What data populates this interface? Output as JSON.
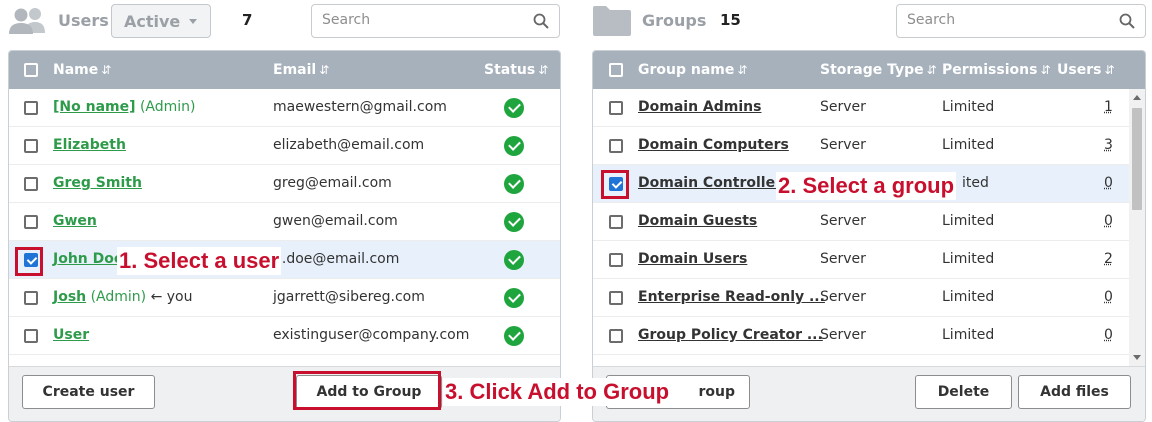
{
  "users_panel": {
    "title": "Users",
    "filter": "Active",
    "count": "7",
    "search_placeholder": "Search",
    "columns": {
      "name": "Name",
      "email": "Email",
      "status": "Status"
    },
    "sort_glyph": "⇵",
    "rows": [
      {
        "name": "[No name]",
        "suffix": "(Admin)",
        "extra": "",
        "email": "maewestern@gmail.com",
        "checked": false
      },
      {
        "name": "Elizabeth",
        "suffix": "",
        "extra": "",
        "email": "elizabeth@email.com",
        "checked": false
      },
      {
        "name": "Greg Smith",
        "suffix": "",
        "extra": "",
        "email": "greg@email.com",
        "checked": false
      },
      {
        "name": "Gwen",
        "suffix": "",
        "extra": "",
        "email": "gwen@email.com",
        "checked": false
      },
      {
        "name": "John Doe",
        "suffix": "",
        "extra": "",
        "email": "n.doe@email.com",
        "checked": true
      },
      {
        "name": "Josh",
        "suffix": "(Admin)",
        "extra": "← you",
        "email": "jgarrett@sibereg.com",
        "checked": false
      },
      {
        "name": "User",
        "suffix": "",
        "extra": "",
        "email": "existinguser@company.com",
        "checked": false
      }
    ],
    "buttons": {
      "create_user": "Create user",
      "add_to_group": "Add to Group"
    }
  },
  "groups_panel": {
    "title": "Groups",
    "count": "15",
    "search_placeholder": "Search",
    "columns": {
      "group_name": "Group name",
      "storage_type": "Storage Type",
      "permissions": "Permissions",
      "users": "Users"
    },
    "rows": [
      {
        "name": "Domain Admins",
        "storage": "Server",
        "permissions": "Limited",
        "users": "1",
        "checked": false
      },
      {
        "name": "Domain Computers",
        "storage": "Server",
        "permissions": "Limited",
        "users": "3",
        "checked": false
      },
      {
        "name": "Domain Controllers",
        "storage": "",
        "permissions": "ited",
        "users": "0",
        "checked": true
      },
      {
        "name": "Domain Guests",
        "storage": "Server",
        "permissions": "Limited",
        "users": "0",
        "checked": false
      },
      {
        "name": "Domain Users",
        "storage": "Server",
        "permissions": "Limited",
        "users": "2",
        "checked": false
      },
      {
        "name": "Enterprise Read-only ...",
        "storage": "Server",
        "permissions": "Limited",
        "users": "0",
        "checked": false
      },
      {
        "name": "Group Policy Creator ...",
        "storage": "Server",
        "permissions": "Limited",
        "users": "0",
        "checked": false
      }
    ],
    "buttons": {
      "hidden_partial": "roup",
      "delete": "Delete",
      "add_files": "Add files"
    }
  },
  "annotations": {
    "step1": "1. Select a user",
    "step2": "2. Select a group",
    "step3": "3. Click Add to Group"
  },
  "colors": {
    "header": "#a6b1bb",
    "link_green": "#2e9b4b",
    "status_green": "#1fa53d",
    "checkbox_blue": "#1f74d6",
    "highlight_red": "#c8102e",
    "selected_row": "#e8f1fb"
  },
  "icons": {
    "users": "users-icon",
    "folder": "folder-icon",
    "search": "search-icon",
    "status": "check-circle-icon",
    "caret": "chevron-down-icon"
  }
}
